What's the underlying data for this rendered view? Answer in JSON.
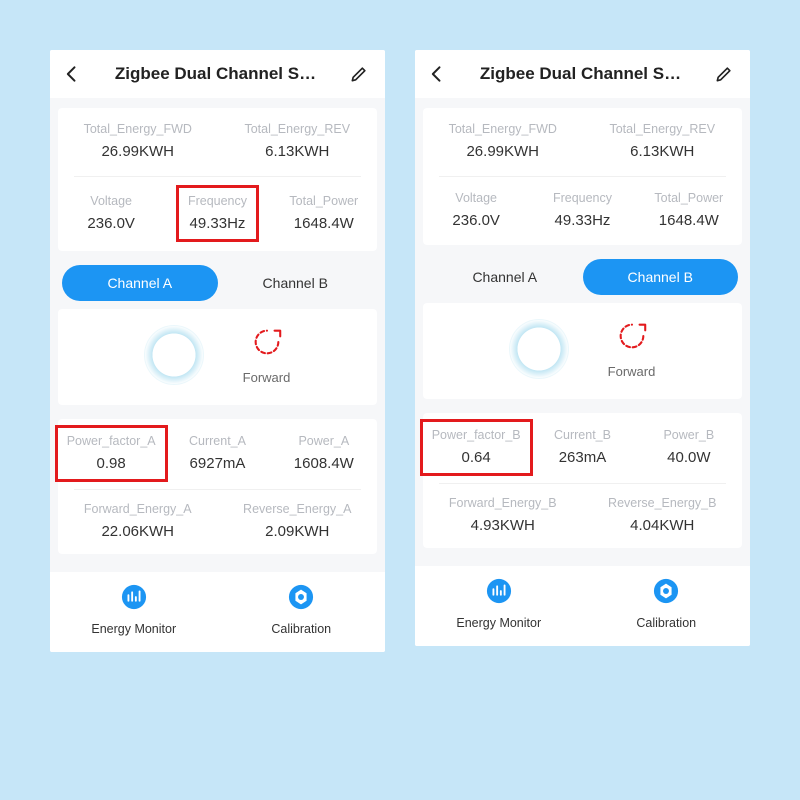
{
  "left": {
    "title": "Zigbee Dual Channel S…",
    "energy": {
      "fwd_label": "Total_Energy_FWD",
      "fwd_value": "26.99KWH",
      "rev_label": "Total_Energy_REV",
      "rev_value": "6.13KWH",
      "voltage_label": "Voltage",
      "voltage_value": "236.0V",
      "freq_label": "Frequency",
      "freq_value": "49.33Hz",
      "power_label": "Total_Power",
      "power_value": "1648.4W"
    },
    "tabs": {
      "a": "Channel A",
      "b": "Channel B",
      "active": "A"
    },
    "direction_label": "Forward",
    "metrics": {
      "pf_label": "Power_factor_A",
      "pf_value": "0.98",
      "cur_label": "Current_A",
      "cur_value": "6927mA",
      "pw_label": "Power_A",
      "pw_value": "1608.4W",
      "fwe_label": "Forward_Energy_A",
      "fwe_value": "22.06KWH",
      "rve_label": "Reverse_Energy_A",
      "rve_value": "2.09KWH"
    },
    "bottom": {
      "monitor": "Energy Monitor",
      "calibration": "Calibration"
    }
  },
  "right": {
    "title": "Zigbee Dual Channel S…",
    "energy": {
      "fwd_label": "Total_Energy_FWD",
      "fwd_value": "26.99KWH",
      "rev_label": "Total_Energy_REV",
      "rev_value": "6.13KWH",
      "voltage_label": "Voltage",
      "voltage_value": "236.0V",
      "freq_label": "Frequency",
      "freq_value": "49.33Hz",
      "power_label": "Total_Power",
      "power_value": "1648.4W"
    },
    "tabs": {
      "a": "Channel A",
      "b": "Channel B",
      "active": "B"
    },
    "direction_label": "Forward",
    "metrics": {
      "pf_label": "Power_factor_B",
      "pf_value": "0.64",
      "cur_label": "Current_B",
      "cur_value": "263mA",
      "pw_label": "Power_B",
      "pw_value": "40.0W",
      "fwe_label": "Forward_Energy_B",
      "fwe_value": "4.93KWH",
      "rve_label": "Reverse_Energy_B",
      "rve_value": "4.04KWH"
    },
    "bottom": {
      "monitor": "Energy Monitor",
      "calibration": "Calibration"
    }
  }
}
